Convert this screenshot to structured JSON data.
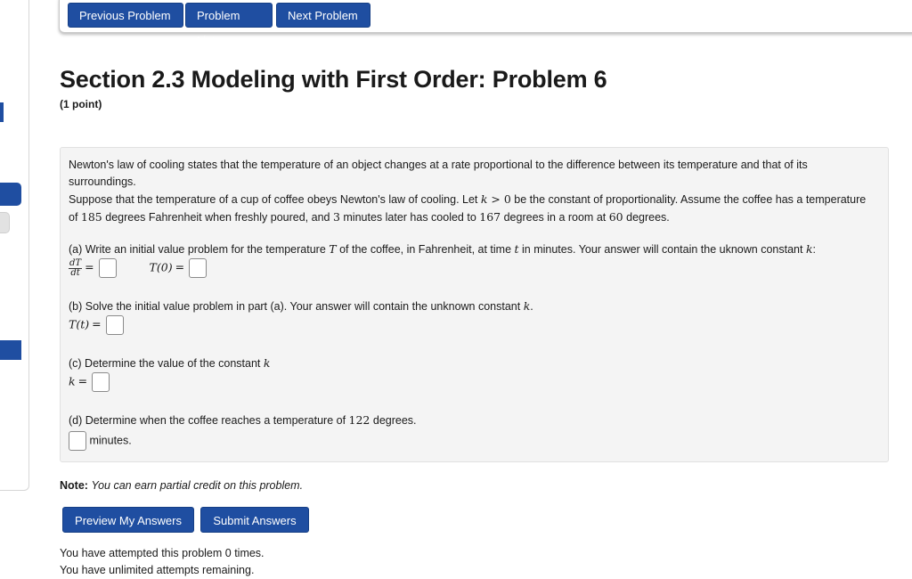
{
  "nav": {
    "previous": "Previous Problem",
    "list": "Problem List",
    "next": "Next Problem"
  },
  "header": {
    "title": "Section 2.3 Modeling with First Order: Problem 6",
    "points": "(1 point)"
  },
  "problem": {
    "intro1": "Newton's law of cooling states that the temperature of an object changes at a rate proportional to the difference between its temperature and that of its surroundings.",
    "intro2_a": "Suppose that the temperature of a cup of coffee obeys Newton's law of cooling. Let ",
    "intro2_k": "k",
    "intro2_gt": " > 0",
    "intro2_b": " be the constant of proportionality. Assume the coffee has a temperature of ",
    "t0": "185",
    "intro2_c": " degrees Fahrenheit when freshly poured, and ",
    "minutes": "3",
    "intro2_d": " minutes later has cooled to ",
    "t1": "167",
    "intro2_e": " degrees in a room at ",
    "room": "60",
    "intro2_f": " degrees.",
    "a_text1": "(a) Write an initial value problem for the temperature ",
    "a_T": "T",
    "a_text2": " of the coffee, in Fahrenheit, at time ",
    "a_t": "t",
    "a_text3": " in minutes. Your answer will contain the uknown constant ",
    "a_k": "k",
    "a_text4": ":",
    "a_frac_top": "dT",
    "a_frac_bot": "dt",
    "a_T0": "T(0)",
    "b_text": "(b) Solve the initial value problem in part (a). Your answer will contain the unknown constant ",
    "b_k": "k",
    "b_end": ".",
    "b_T": "T(t)",
    "c_text": "(c) Determine the value of the constant ",
    "c_k": "k",
    "c_var": "k",
    "d_text1": "(d) Determine when the coffee reaches a temperature of ",
    "d_temp": "122",
    "d_text2": " degrees.",
    "d_unit": "minutes."
  },
  "note": {
    "label": "Note:",
    "text": "You can earn partial credit on this problem."
  },
  "actions": {
    "preview": "Preview My Answers",
    "submit": "Submit Answers"
  },
  "status": {
    "attempts": "You have attempted this problem 0 times.",
    "remaining": "You have unlimited attempts remaining."
  },
  "colors": {
    "accent": "#1f4ea1",
    "panel": "#f4f4f4"
  }
}
